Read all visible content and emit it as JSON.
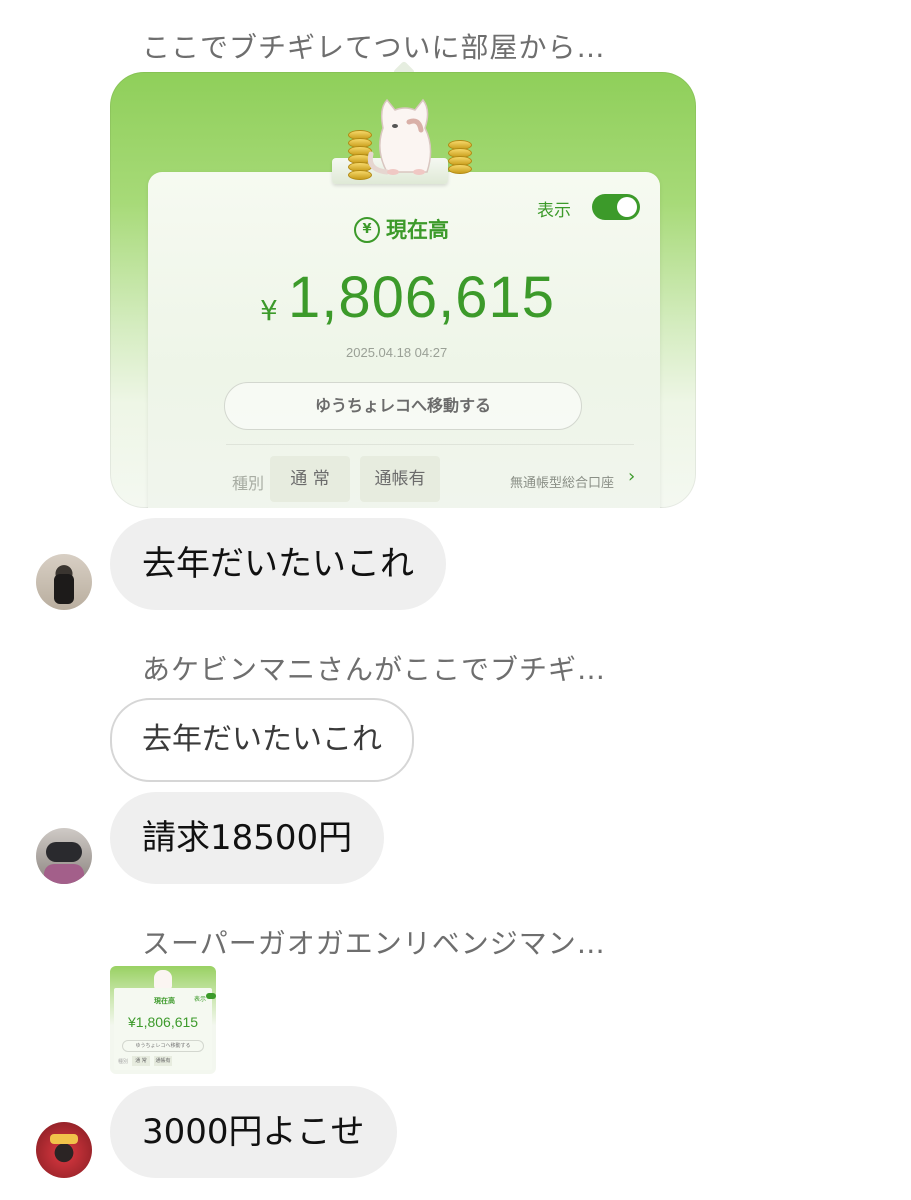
{
  "messages": {
    "reply_label_1": "ここでブチギレてついに部屋から…",
    "card": {
      "current_label": "現在高",
      "yen_icon_glyph": "¥",
      "display_label": "表示",
      "yen_sign": "¥",
      "balance": "1,806,615",
      "timestamp": "2025.04.18 04:27",
      "move_button": "ゆうちょレコへ移動する",
      "kind_label": "種別",
      "chip_normal": "通 常",
      "chip_passbook": "通帳有",
      "account_link": "無通帳型総合口座",
      "toggle_on": true
    },
    "bubble_1": "去年だいたいこれ",
    "reply_label_2": "あケビンマニさんがここでブチギ…",
    "quoted_text": "去年だいたいこれ",
    "bubble_2": "請求18500円",
    "reply_label_3": "スーパーガオガエンリベンジマン…",
    "thumbnail": {
      "current_label": "現在高",
      "display_label": "表示",
      "balance": "¥1,806,615",
      "move_button": "ゆうちょレコへ移動する",
      "kind_label": "種別",
      "chip_normal": "通 常",
      "chip_passbook": "通帳有"
    },
    "bubble_3": "3000円よこせ"
  },
  "colors": {
    "accent_green": "#3c9a2a",
    "bubble_gray": "#efefef",
    "label_gray": "#6e6e6e"
  }
}
